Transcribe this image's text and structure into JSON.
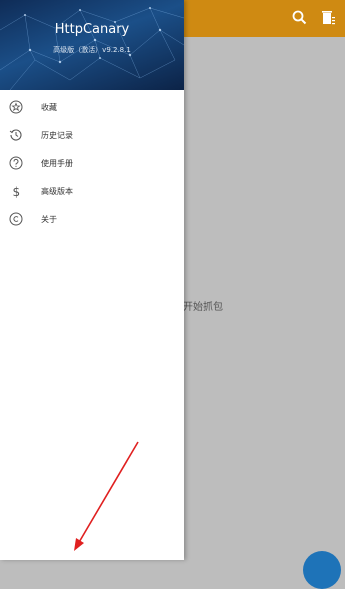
{
  "app": {
    "title": "HttpCanary",
    "version": "高级版（激活）v9.2.8.1"
  },
  "toolbar": {
    "search_icon": "search-icon",
    "delete_icon": "delete-icon"
  },
  "main": {
    "hint": "开始抓包"
  },
  "drawer": {
    "items": [
      {
        "label": "收藏",
        "icon": "star-icon"
      },
      {
        "label": "历史记录",
        "icon": "history-icon"
      },
      {
        "label": "使用手册",
        "icon": "help-icon"
      },
      {
        "label": "高级版本",
        "icon": "dollar-icon"
      },
      {
        "label": "关于",
        "icon": "copyright-icon"
      }
    ]
  },
  "colors": {
    "appbar": "#cf8a12",
    "drawer_header": "#1b4f88",
    "fab": "#1e73b8",
    "annotation_arrow": "#e02020"
  }
}
